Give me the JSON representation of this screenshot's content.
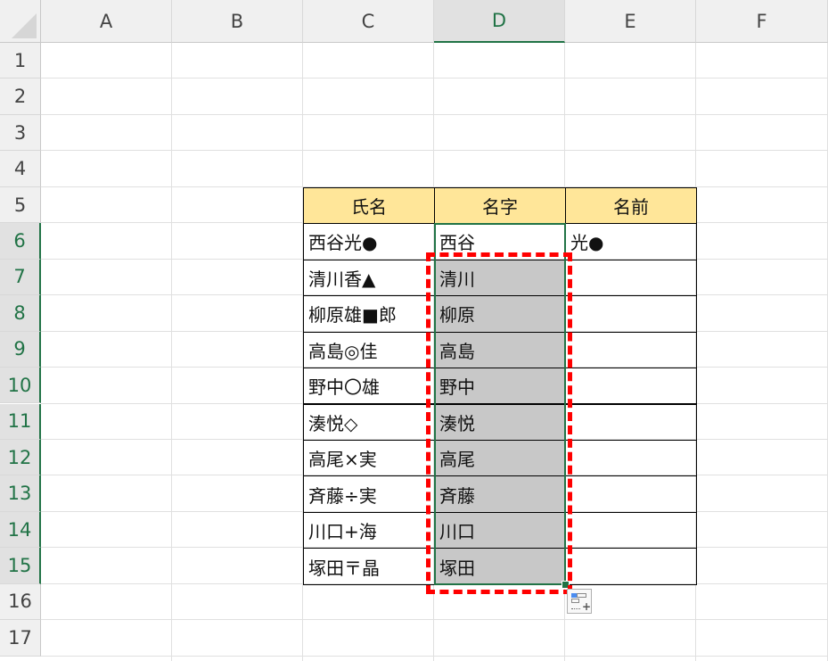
{
  "columns": [
    "A",
    "B",
    "C",
    "D",
    "E",
    "F"
  ],
  "rows": [
    "1",
    "2",
    "3",
    "4",
    "5",
    "6",
    "7",
    "8",
    "9",
    "10",
    "11",
    "12",
    "13",
    "14",
    "15",
    "16",
    "17"
  ],
  "table": {
    "headers": [
      "氏名",
      "名字",
      "名前"
    ],
    "rows": [
      [
        "西谷光●",
        "西谷",
        "光●"
      ],
      [
        "清川香▲",
        "清川",
        ""
      ],
      [
        "柳原雄■郎",
        "柳原",
        ""
      ],
      [
        "高島◎佳",
        "高島",
        ""
      ],
      [
        "野中〇雄",
        "野中",
        ""
      ],
      [
        "湊悦◇",
        "湊悦",
        ""
      ],
      [
        "高尾×実",
        "高尾",
        ""
      ],
      [
        "斉藤÷実",
        "斉藤",
        ""
      ],
      [
        "川口+海",
        "川口",
        ""
      ],
      [
        "塚田〒晶",
        "塚田",
        ""
      ]
    ]
  },
  "colors": {
    "header_fill": "#ffe699",
    "selection_fill": "#c8c8c8",
    "selection_border": "#217346",
    "highlight": "#ff0000"
  },
  "flash_fill_icon": "flash-fill-options-icon"
}
